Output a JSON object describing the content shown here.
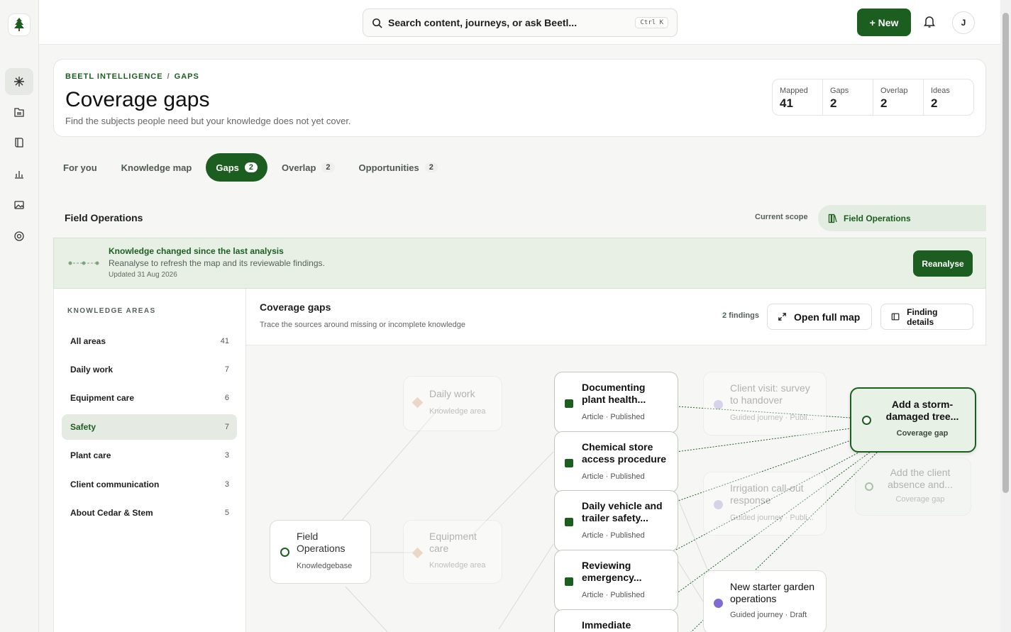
{
  "app": {
    "logo_icon": "tree-icon"
  },
  "topbar": {
    "search_placeholder": "Search content, journeys, or ask Beetl...",
    "shortcut": "Ctrl K",
    "new_label": "+ New",
    "avatar_initial": "J"
  },
  "header": {
    "breadcrumb": [
      "BEETL INTELLIGENCE",
      "GAPS"
    ],
    "breadcrumb_sep": "/",
    "title": "Coverage gaps",
    "subtitle": "Find the subjects people need but your knowledge does not yet cover.",
    "stats": [
      {
        "label": "Mapped",
        "value": "41"
      },
      {
        "label": "Gaps",
        "value": "2"
      },
      {
        "label": "Overlap",
        "value": "2"
      },
      {
        "label": "Ideas",
        "value": "2"
      }
    ]
  },
  "tabs": [
    {
      "label": "For you",
      "badge": ""
    },
    {
      "label": "Knowledge map",
      "badge": ""
    },
    {
      "label": "Gaps",
      "badge": "2",
      "active": true
    },
    {
      "label": "Overlap",
      "badge": "2"
    },
    {
      "label": "Opportunities",
      "badge": "2"
    }
  ],
  "scope": {
    "name": "Field Operations",
    "label": "Current scope",
    "pill": "Field Operations"
  },
  "banner": {
    "title": "Knowledge changed since the last analysis",
    "subtitle": "Reanalyse to refresh the map and its reviewable findings.",
    "updated": "Updated 31 Aug 2026",
    "button": "Reanalyse"
  },
  "areas": {
    "heading": "KNOWLEDGE AREAS",
    "items": [
      {
        "label": "All areas",
        "count": "41"
      },
      {
        "label": "Daily work",
        "count": "7"
      },
      {
        "label": "Equipment care",
        "count": "6"
      },
      {
        "label": "Safety",
        "count": "7",
        "active": true
      },
      {
        "label": "Plant care",
        "count": "3"
      },
      {
        "label": "Client communication",
        "count": "3"
      },
      {
        "label": "About Cedar & Stem",
        "count": "5"
      }
    ]
  },
  "content": {
    "title": "Coverage gaps",
    "subtitle": "Trace the sources around missing or incomplete knowledge",
    "findings": "2 findings",
    "open_map": "Open full map",
    "finding_details": "Finding details"
  },
  "graph": {
    "kb": {
      "title": "Field Operations",
      "meta": "Knowledgebase"
    },
    "areas": [
      {
        "title": "Daily work",
        "meta": "Knowledge area"
      },
      {
        "title": "Equipment care",
        "meta": "Knowledge area"
      }
    ],
    "articles": [
      {
        "title": "Documenting plant health...",
        "meta": "Article · Published"
      },
      {
        "title": "Chemical store access procedure",
        "meta": "Article · Published"
      },
      {
        "title": "Daily vehicle and trailer safety...",
        "meta": "Article · Published"
      },
      {
        "title": "Reviewing emergency...",
        "meta": "Article · Published"
      },
      {
        "title": "Immediate",
        "meta": ""
      }
    ],
    "journeys": [
      {
        "title": "Client visit: survey to handover",
        "meta": "Guided journey · Publi..."
      },
      {
        "title": "Irrigation call-out response",
        "meta": "Guided journey · Publi..."
      },
      {
        "title": "New starter garden operations",
        "meta": "Guided journey · Draft"
      }
    ],
    "gaps": [
      {
        "title": "Add a storm-damaged tree...",
        "meta": "Coverage gap"
      },
      {
        "title": "Add the client absence and...",
        "meta": "Coverage gap"
      }
    ]
  }
}
